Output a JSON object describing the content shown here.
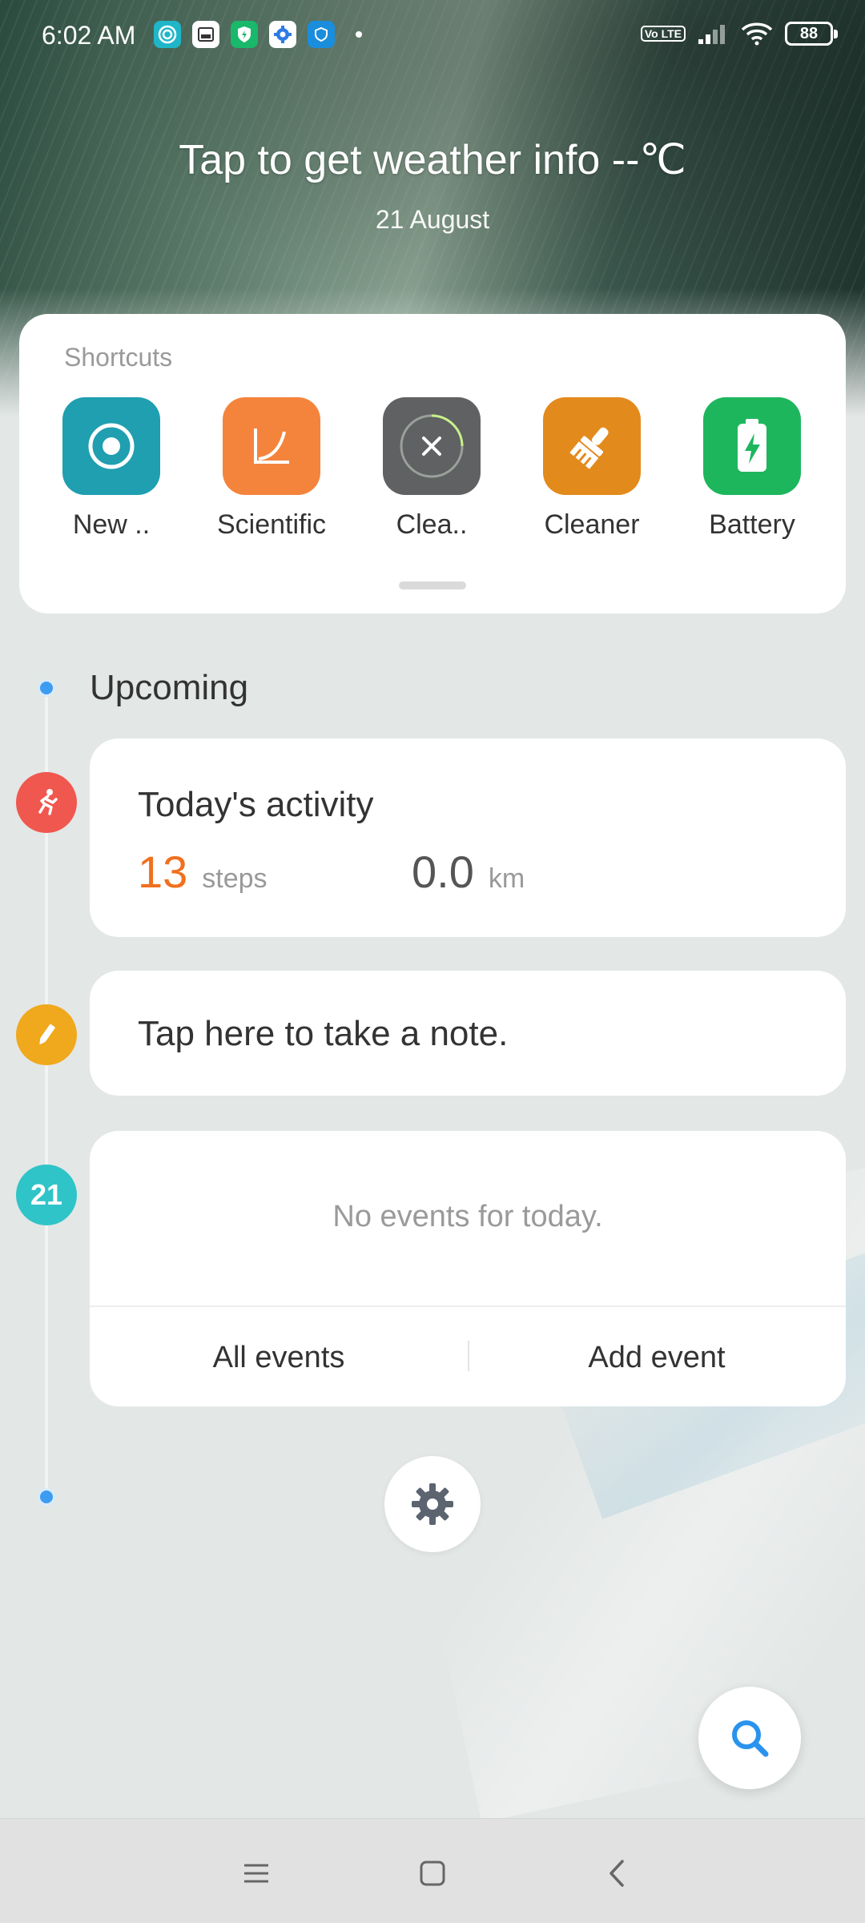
{
  "status_bar": {
    "time": "6:02 AM",
    "notification_icons": [
      "target-icon",
      "photo-app-icon",
      "shield-icon",
      "settings-gear-icon",
      "security-badge-icon"
    ],
    "volte": "Vo LTE",
    "battery": "88"
  },
  "weather": {
    "title": "Tap to get weather info --℃",
    "date": "21 August"
  },
  "shortcuts": {
    "header": "Shortcuts",
    "items": [
      {
        "label": "New ..",
        "icon": "record-icon",
        "color": "#1f9fb0"
      },
      {
        "label": "Scientific",
        "icon": "curve-graph-icon",
        "color": "#f4843c"
      },
      {
        "label": "Clea..",
        "icon": "close-circle-icon",
        "color": "#5f6162"
      },
      {
        "label": "Cleaner",
        "icon": "brush-icon",
        "color": "#e38a1d"
      },
      {
        "label": "Battery",
        "icon": "battery-bolt-icon",
        "color": "#1eb65d"
      }
    ]
  },
  "upcoming": {
    "title": "Upcoming"
  },
  "activity": {
    "title": "Today's activity",
    "steps_value": "13",
    "steps_unit": "steps",
    "distance_value": "0.0",
    "distance_unit": "km",
    "badge_color": "#f0574e"
  },
  "note": {
    "text": "Tap here to take a note.",
    "badge_color": "#f0a81c"
  },
  "events": {
    "badge_day": "21",
    "badge_color": "#2fc4c8",
    "empty_text": "No events for today.",
    "all_events_label": "All events",
    "add_event_label": "Add event"
  },
  "colors": {
    "accent_blue": "#3d9cf0",
    "steps_orange": "#f0701e"
  }
}
